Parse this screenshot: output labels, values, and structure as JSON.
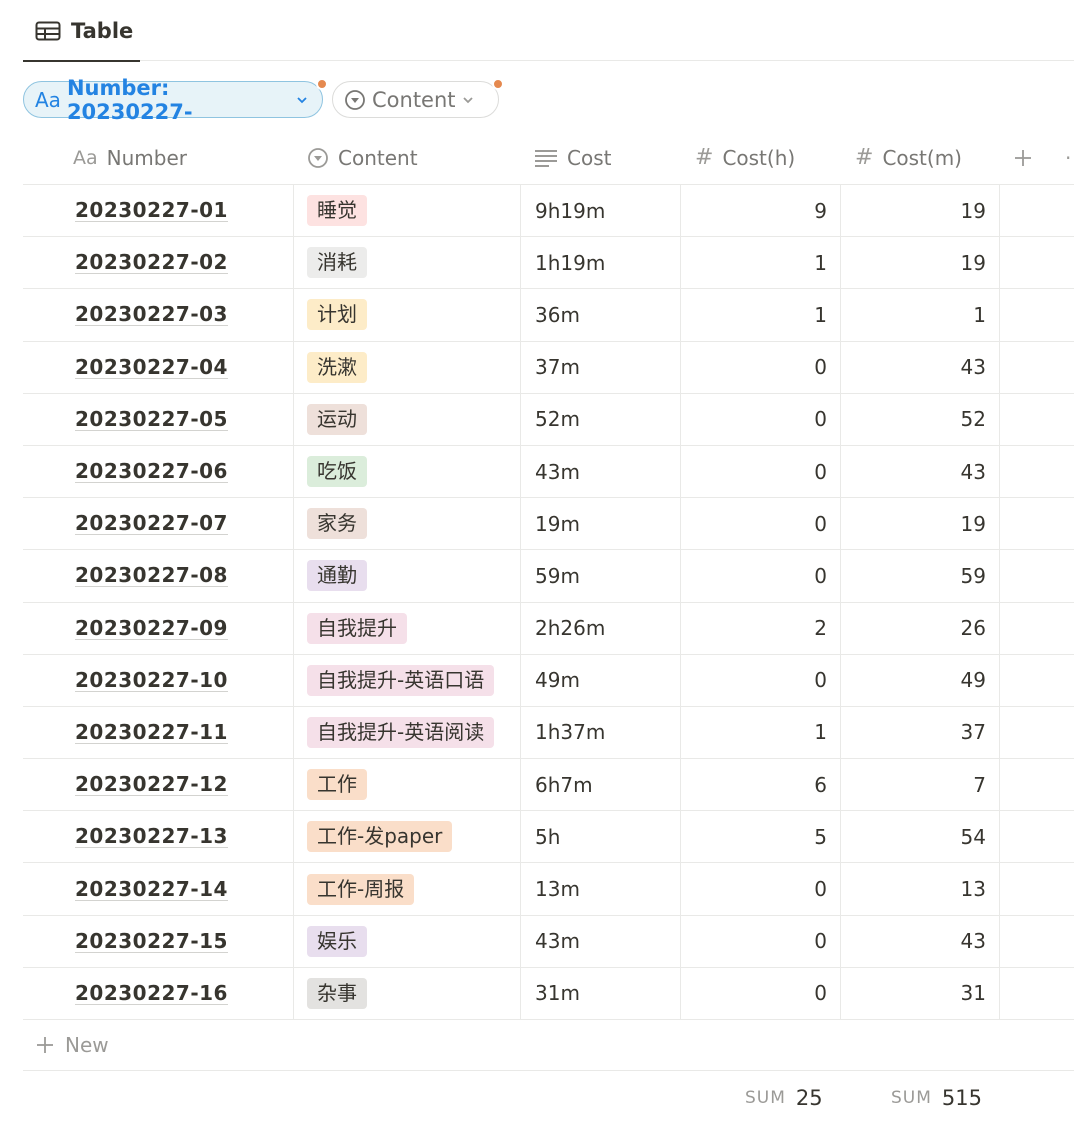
{
  "view_tab": {
    "label": "Table",
    "icon": "table-icon"
  },
  "filters": [
    {
      "label": "Number: 20230227-",
      "icon": "text-property-icon",
      "active": true
    },
    {
      "label": "Content",
      "icon": "select-property-icon",
      "active": false
    }
  ],
  "columns": [
    {
      "label": "Number",
      "icon": "text-property-icon"
    },
    {
      "label": "Content",
      "icon": "select-property-icon"
    },
    {
      "label": "Cost",
      "icon": "lines-property-icon"
    },
    {
      "label": "Cost(h)",
      "icon": "hash-icon"
    },
    {
      "label": "Cost(m)",
      "icon": "hash-icon"
    }
  ],
  "rows": [
    {
      "number": "20230227-01",
      "content": "睡觉",
      "tag_color": "#fde2e1",
      "cost": "9h19m",
      "cost_h": "9",
      "cost_m": "19"
    },
    {
      "number": "20230227-02",
      "content": "消耗",
      "tag_color": "#ececeb",
      "cost": "1h19m",
      "cost_h": "1",
      "cost_m": "19"
    },
    {
      "number": "20230227-03",
      "content": "计划",
      "tag_color": "#fdecc8",
      "cost": "36m",
      "cost_h": "1",
      "cost_m": "1"
    },
    {
      "number": "20230227-04",
      "content": "洗漱",
      "tag_color": "#fdecc8",
      "cost": "37m",
      "cost_h": "0",
      "cost_m": "43"
    },
    {
      "number": "20230227-05",
      "content": "运动",
      "tag_color": "#eee0da",
      "cost": "52m",
      "cost_h": "0",
      "cost_m": "52"
    },
    {
      "number": "20230227-06",
      "content": "吃饭",
      "tag_color": "#dbeddb",
      "cost": "43m",
      "cost_h": "0",
      "cost_m": "43"
    },
    {
      "number": "20230227-07",
      "content": "家务",
      "tag_color": "#eee0da",
      "cost": "19m",
      "cost_h": "0",
      "cost_m": "19"
    },
    {
      "number": "20230227-08",
      "content": "通勤",
      "tag_color": "#e8deee",
      "cost": "59m",
      "cost_h": "0",
      "cost_m": "59"
    },
    {
      "number": "20230227-09",
      "content": "自我提升",
      "tag_color": "#f5e0e9",
      "cost": "2h26m",
      "cost_h": "2",
      "cost_m": "26"
    },
    {
      "number": "20230227-10",
      "content": "自我提升-英语口语",
      "tag_color": "#f5e0e9",
      "cost": "49m",
      "cost_h": "0",
      "cost_m": "49"
    },
    {
      "number": "20230227-11",
      "content": "自我提升-英语阅读",
      "tag_color": "#f5e0e9",
      "cost": "1h37m",
      "cost_h": "1",
      "cost_m": "37"
    },
    {
      "number": "20230227-12",
      "content": "工作",
      "tag_color": "#fadec9",
      "cost": "6h7m",
      "cost_h": "6",
      "cost_m": "7"
    },
    {
      "number": "20230227-13",
      "content": "工作-发paper",
      "tag_color": "#fadec9",
      "cost": "5h",
      "cost_h": "5",
      "cost_m": "54"
    },
    {
      "number": "20230227-14",
      "content": "工作-周报",
      "tag_color": "#fadec9",
      "cost": "13m",
      "cost_h": "0",
      "cost_m": "13"
    },
    {
      "number": "20230227-15",
      "content": "娱乐",
      "tag_color": "#e8deee",
      "cost": "43m",
      "cost_h": "0",
      "cost_m": "43"
    },
    {
      "number": "20230227-16",
      "content": "杂事",
      "tag_color": "#e3e2e0",
      "cost": "31m",
      "cost_h": "0",
      "cost_m": "31"
    }
  ],
  "new_row_label": "New",
  "sums": {
    "cost_h": {
      "label": "SUM",
      "value": "25"
    },
    "cost_m": {
      "label": "SUM",
      "value": "515"
    }
  },
  "accent_color": "#2383e2",
  "filter_dot_color": "#e5894f"
}
